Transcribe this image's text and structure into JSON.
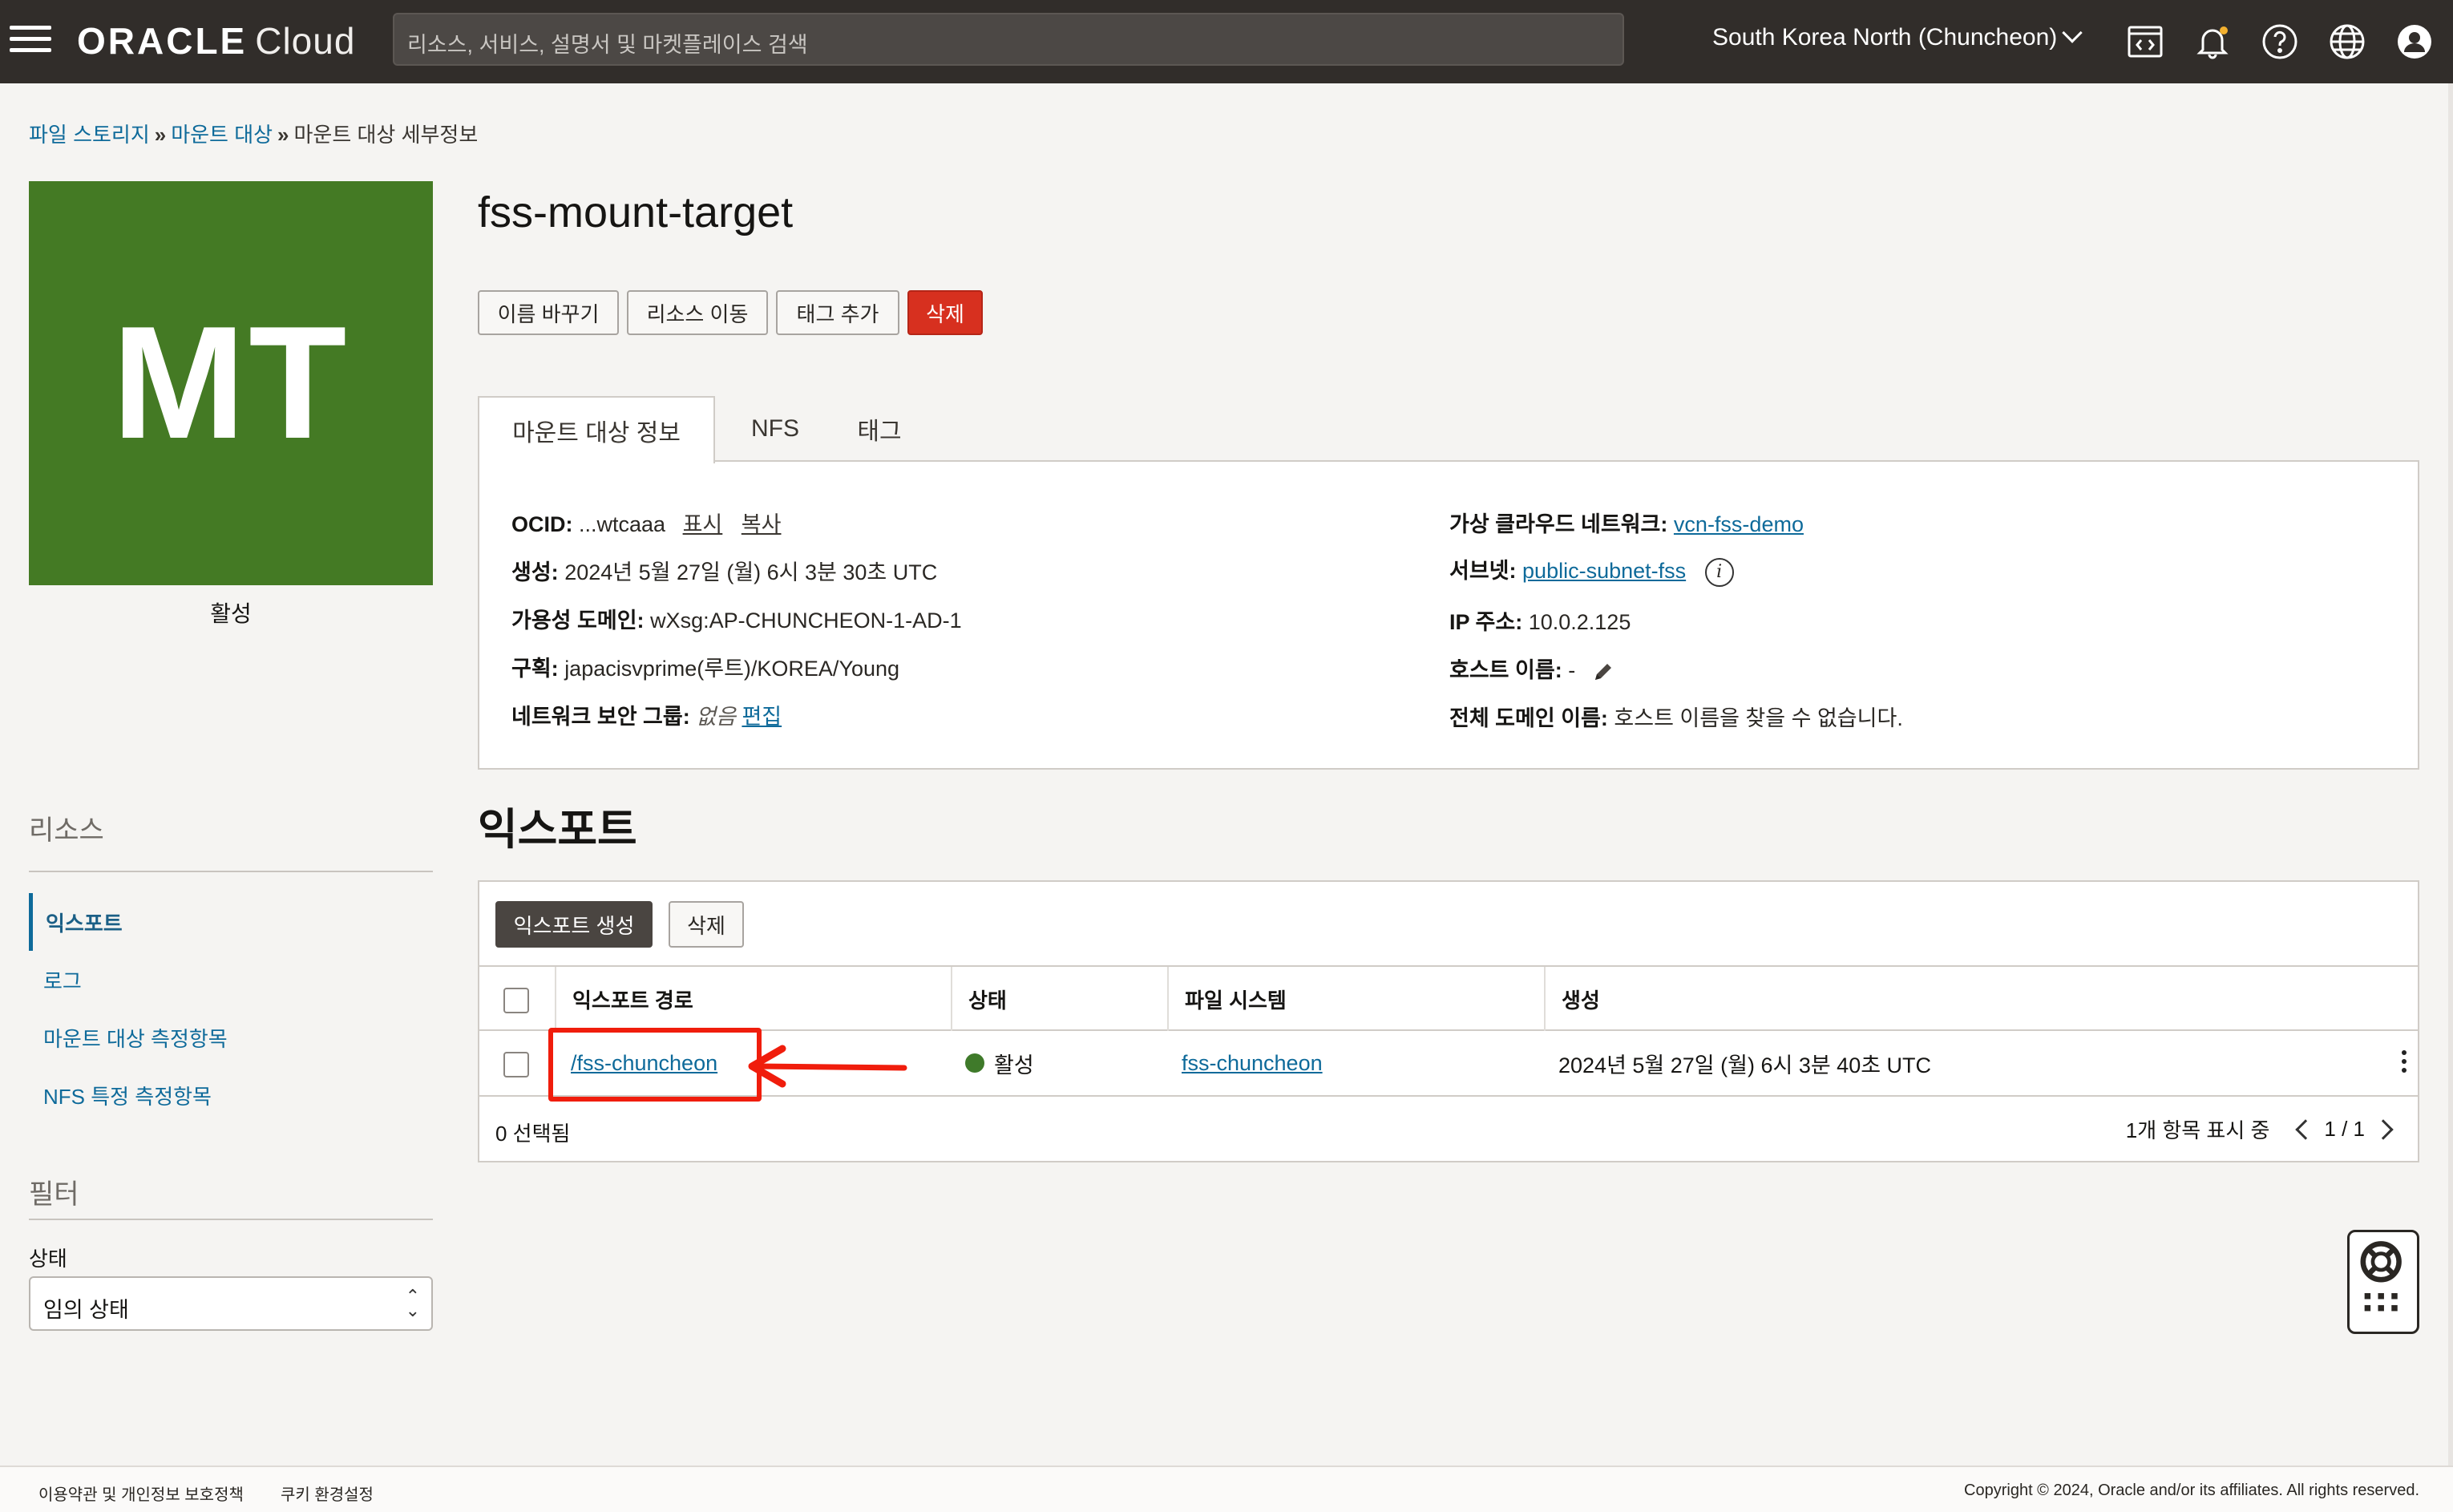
{
  "header": {
    "brand_bold": "ORACLE",
    "brand_light": "Cloud",
    "search_placeholder": "리소스, 서비스, 설명서 및 마켓플레이스 검색",
    "region": "South Korea North (Chuncheon)",
    "icons": [
      "hamburger-menu-icon",
      "code-editor-icon",
      "bell-icon",
      "help-icon",
      "globe-icon",
      "user-icon"
    ]
  },
  "breadcrumb": {
    "items": [
      "파일 스토리지",
      "마운트 대상",
      "마운트 대상 세부정보"
    ],
    "separator": "»"
  },
  "resource": {
    "tile_text": "MT",
    "tile_color": "#447a24",
    "status": "활성",
    "title": "fss-mount-target"
  },
  "actions": {
    "rename": "이름 바꾸기",
    "move": "리소스 이동",
    "add_tag": "태그 추가",
    "delete": "삭제"
  },
  "tabs": [
    "마운트 대상 정보",
    "NFS",
    "태그"
  ],
  "info": {
    "ocid_label": "OCID:",
    "ocid_value": "...wtcaaa",
    "ocid_show": "표시",
    "ocid_copy": "복사",
    "created_label": "생성:",
    "created_value": "2024년 5월 27일 (월) 6시 3분 30초 UTC",
    "ad_label": "가용성 도메인:",
    "ad_value": "wXsg:AP-CHUNCHEON-1-AD-1",
    "compartment_label": "구획:",
    "compartment_value": "japacisvprime(루트)/KOREA/Young",
    "nsg_label": "네트워크 보안 그룹:",
    "nsg_value": "없음",
    "nsg_edit": "편집",
    "vcn_label": "가상 클라우드 네트워크:",
    "vcn_value": "vcn-fss-demo",
    "subnet_label": "서브넷:",
    "subnet_value": "public-subnet-fss",
    "ip_label": "IP 주소:",
    "ip_value": "10.0.2.125",
    "hostname_label": "호스트 이름:",
    "hostname_value": "-",
    "fqdn_label": "전체 도메인 이름:",
    "fqdn_value": "호스트 이름을 찾을 수 없습니다."
  },
  "left": {
    "resources_title": "리소스",
    "nav": [
      "익스포트",
      "로그",
      "마운트 대상 측정항목",
      "NFS 특정 측정항목"
    ],
    "filter_title": "필터",
    "state_label": "상태",
    "state_value": "임의 상태"
  },
  "exports": {
    "title": "익스포트",
    "create_button": "익스포트 생성",
    "delete_button": "삭제",
    "columns": [
      "익스포트 경로",
      "상태",
      "파일 시스템",
      "생성"
    ],
    "rows": [
      {
        "path": "/fss-chuncheon",
        "state": "활성",
        "state_color": "#3f7a2a",
        "file_system": "fss-chuncheon",
        "created": "2024년 5월 27일 (월) 6시 3분 40초 UTC"
      }
    ],
    "selected": "0 선택됨",
    "showing": "1개 항목 표시 중",
    "page": "1 / 1"
  },
  "footer": {
    "terms": "이용약관 및 개인정보 보호정책",
    "cookies": "쿠키 환경설정",
    "copyright": "Copyright © 2024, Oracle and/or its affiliates. All rights reserved."
  },
  "colors": {
    "topbar": "#312d2a",
    "link": "#0e6a9a",
    "danger": "#d7301f",
    "annotation": "#f01d0c"
  }
}
